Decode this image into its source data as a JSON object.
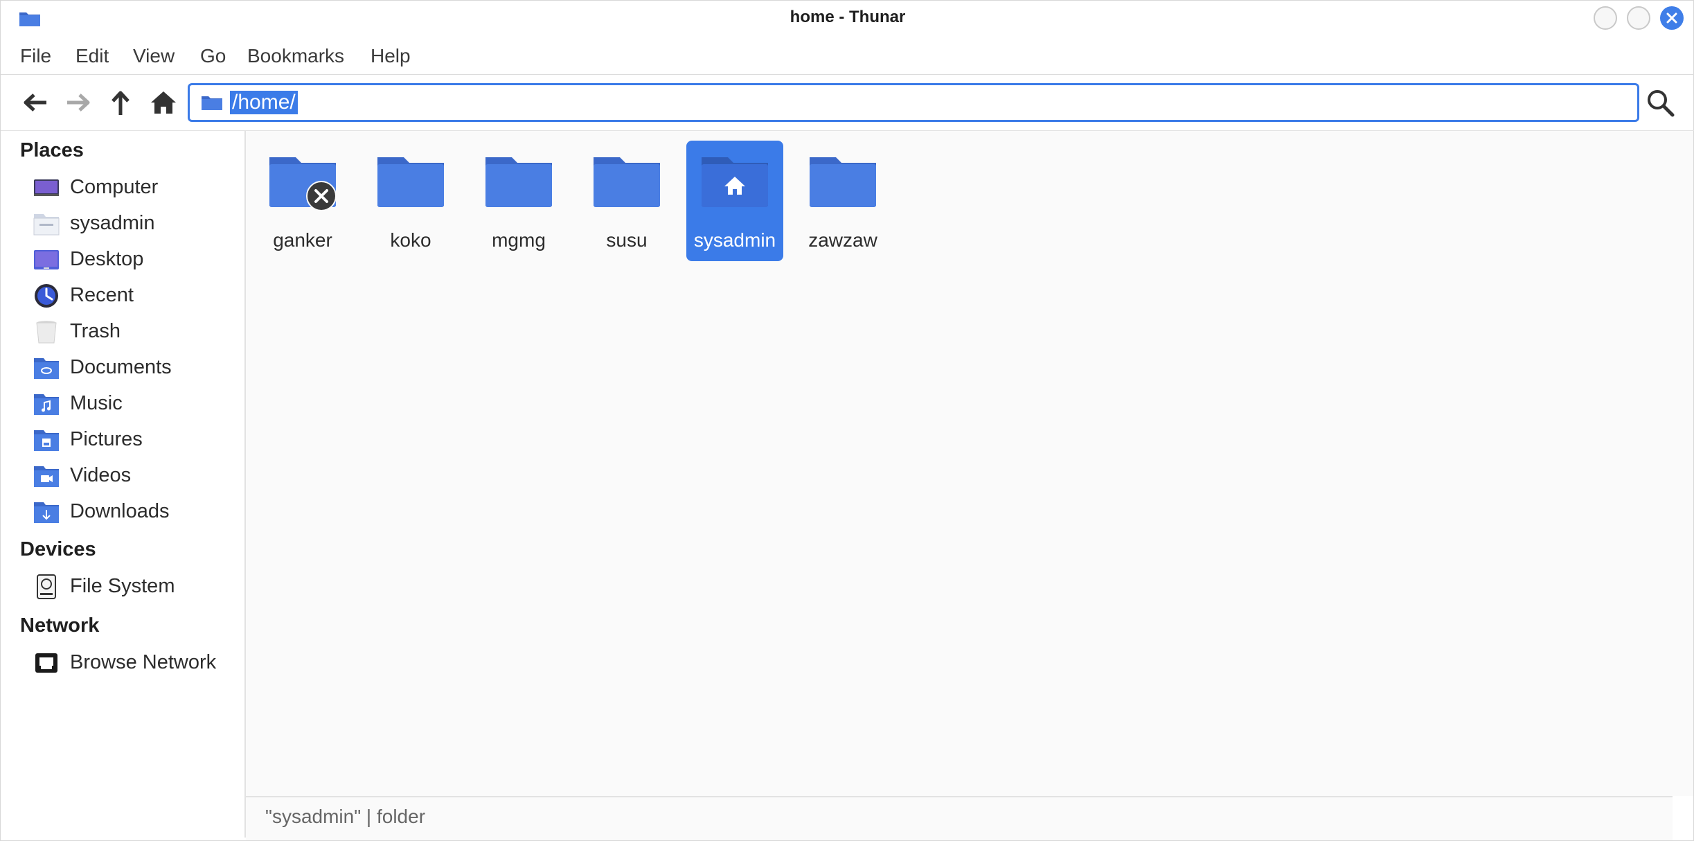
{
  "window": {
    "title": "home - Thunar"
  },
  "menu": [
    "File",
    "Edit",
    "View",
    "Go",
    "Bookmarks",
    "Help"
  ],
  "toolbar": {
    "location": "/home/",
    "buttons": [
      "back-arrow-icon",
      "forward-arrow-icon",
      "up-arrow-icon",
      "home-icon",
      "search-icon"
    ]
  },
  "sidebar": {
    "places_label": "Places",
    "places": [
      {
        "label": "Computer",
        "icon": "computer-icon"
      },
      {
        "label": "sysadmin",
        "icon": "home-folder-icon"
      },
      {
        "label": "Desktop",
        "icon": "desktop-icon"
      },
      {
        "label": "Recent",
        "icon": "clock-icon"
      },
      {
        "label": "Trash",
        "icon": "trash-icon"
      },
      {
        "label": "Documents",
        "icon": "documents-folder-icon"
      },
      {
        "label": "Music",
        "icon": "music-folder-icon"
      },
      {
        "label": "Pictures",
        "icon": "pictures-folder-icon"
      },
      {
        "label": "Videos",
        "icon": "videos-folder-icon"
      },
      {
        "label": "Downloads",
        "icon": "downloads-folder-icon"
      }
    ],
    "devices_label": "Devices",
    "devices": [
      {
        "label": "File System",
        "icon": "drive-icon"
      }
    ],
    "network_label": "Network",
    "network": [
      {
        "label": "Browse Network",
        "icon": "network-icon"
      }
    ]
  },
  "files": [
    {
      "name": "ganker",
      "icon": "folder-unreadable-icon"
    },
    {
      "name": "koko",
      "icon": "folder-icon"
    },
    {
      "name": "mgmg",
      "icon": "folder-icon"
    },
    {
      "name": "susu",
      "icon": "folder-icon"
    },
    {
      "name": "sysadmin",
      "icon": "home-folder-icon",
      "selected": true
    },
    {
      "name": "zawzaw",
      "icon": "folder-icon"
    }
  ],
  "status": "\"sysadmin\" | folder",
  "colors": {
    "accent": "#3b7be8",
    "folder": "#4a7ee3",
    "folder_dark": "#3b68c9"
  }
}
